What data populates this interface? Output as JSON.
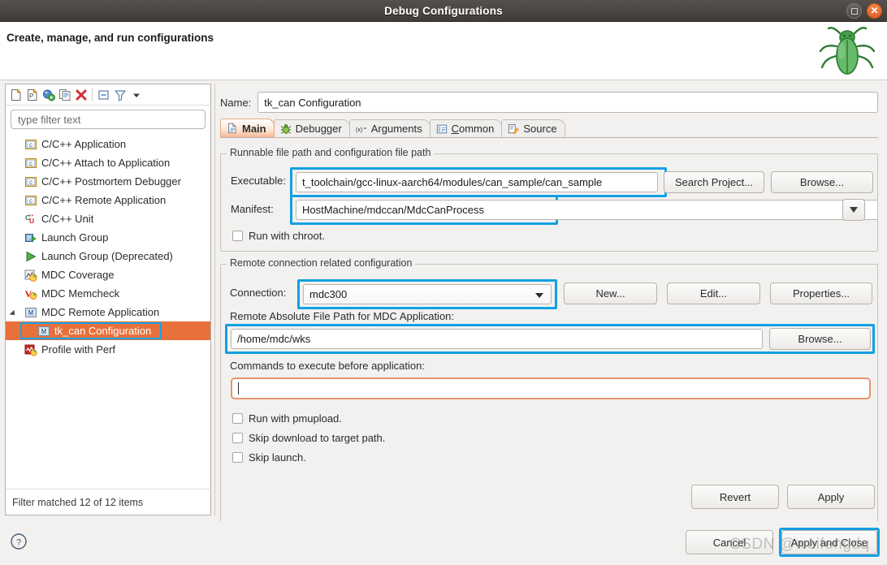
{
  "window": {
    "title": "Debug Configurations",
    "restore_tooltip": "Restore",
    "close_tooltip": "Close"
  },
  "banner": {
    "title": "Create, manage, and run configurations",
    "icon": "bug-icon"
  },
  "sidebar": {
    "toolbar": [
      {
        "name": "new-configuration-icon",
        "label": "New launch configuration"
      },
      {
        "name": "new-prototype-icon",
        "label": "New launch configuration prototype"
      },
      {
        "name": "export-icon",
        "label": "Export"
      },
      {
        "name": "duplicate-icon",
        "label": "Duplicate"
      },
      {
        "name": "delete-icon",
        "label": "Delete"
      },
      {
        "name": "collapse-all-icon",
        "label": "Collapse All"
      },
      {
        "name": "filter-icon",
        "label": "Filter launch configurations"
      },
      {
        "name": "view-menu-icon",
        "label": "View Menu"
      }
    ],
    "filter": {
      "placeholder": "type filter text",
      "value": ""
    },
    "items": [
      {
        "label": "C/C++ Application",
        "icon": "c-app-icon",
        "indent": 0,
        "selected": false,
        "expander": "none"
      },
      {
        "label": "C/C++ Attach to Application",
        "icon": "c-app-icon",
        "indent": 0,
        "selected": false,
        "expander": "none"
      },
      {
        "label": "C/C++ Postmortem Debugger",
        "icon": "c-app-icon",
        "indent": 0,
        "selected": false,
        "expander": "none"
      },
      {
        "label": "C/C++ Remote Application",
        "icon": "c-app-icon",
        "indent": 0,
        "selected": false,
        "expander": "none"
      },
      {
        "label": "C/C++ Unit",
        "icon": "cunit-icon",
        "indent": 0,
        "selected": false,
        "expander": "none"
      },
      {
        "label": "Launch Group",
        "icon": "launch-group-icon",
        "indent": 0,
        "selected": false,
        "expander": "none"
      },
      {
        "label": "Launch Group (Deprecated)",
        "icon": "launch-group-deprecated-icon",
        "indent": 0,
        "selected": false,
        "expander": "none"
      },
      {
        "label": "MDC Coverage",
        "icon": "mdc-coverage-icon",
        "indent": 0,
        "selected": false,
        "expander": "none"
      },
      {
        "label": "MDC Memcheck",
        "icon": "mdc-memcheck-icon",
        "indent": 0,
        "selected": false,
        "expander": "none"
      },
      {
        "label": "MDC Remote Application",
        "icon": "mdc-remote-icon",
        "indent": 0,
        "selected": false,
        "expander": "open"
      },
      {
        "label": "tk_can Configuration",
        "icon": "mdc-remote-icon",
        "indent": 1,
        "selected": true,
        "expander": "none"
      },
      {
        "label": "Profile with Perf",
        "icon": "perf-icon",
        "indent": 0,
        "selected": false,
        "expander": "none"
      }
    ],
    "status": "Filter matched 12 of 12 items"
  },
  "main": {
    "name_label": "Name:",
    "name_value": "tk_can Configuration",
    "tabs": [
      {
        "label": "Main",
        "icon": "main-tab-icon",
        "active": true,
        "mnemonic": ""
      },
      {
        "label": "Debugger",
        "icon": "debugger-tab-icon",
        "active": false,
        "mnemonic": ""
      },
      {
        "label": "Arguments",
        "icon": "arguments-tab-icon",
        "active": false,
        "mnemonic": ""
      },
      {
        "label": "Common",
        "icon": "common-tab-icon",
        "active": false,
        "mnemonic": "C"
      },
      {
        "label": "Source",
        "icon": "source-tab-icon",
        "active": false,
        "mnemonic": ""
      }
    ],
    "group_runnable": {
      "title": "Runnable file path and configuration file path",
      "executable_label": "Executable:",
      "executable_value": "t_toolchain/gcc-linux-aarch64/modules/can_sample/can_sample",
      "search_project_button": "Search Project...",
      "browse_button": "Browse...",
      "manifest_label": "Manifest:",
      "manifest_value": "HostMachine/mdccan/MdcCanProcess",
      "chroot_checkbox": "Run with chroot.",
      "chroot_checked": false
    },
    "group_remote": {
      "title": "Remote connection related configuration",
      "connection_label": "Connection:",
      "connection_value": "mdc300",
      "new_button": "New...",
      "edit_button": "Edit...",
      "properties_button": "Properties...",
      "remote_path_label": "Remote Absolute File Path for MDC Application:",
      "remote_path_value": "/home/mdc/wks",
      "remote_browse_button": "Browse...",
      "commands_label": "Commands to execute before application:",
      "commands_value": "",
      "checkboxes": [
        {
          "label": "Run with pmupload.",
          "checked": false
        },
        {
          "label": "Skip download to target path.",
          "checked": false
        },
        {
          "label": "Skip launch.",
          "checked": false
        }
      ]
    },
    "revert_button": "Revert",
    "apply_button": "Apply"
  },
  "footer": {
    "help_icon": "help-icon",
    "cancel_button": "Cancel",
    "apply_and_close_button": "Apply and Close"
  },
  "watermark": {
    "text": "CSDN @weifengdq"
  },
  "colors": {
    "selection_orange": "#e8703a",
    "focus_blue": "#13a0e3",
    "tab_active_orange": "#f6b893",
    "cmd_focus_orange": "#e8956b",
    "titlebar_dark": "#4a4541",
    "close_orange": "#e2622a"
  }
}
